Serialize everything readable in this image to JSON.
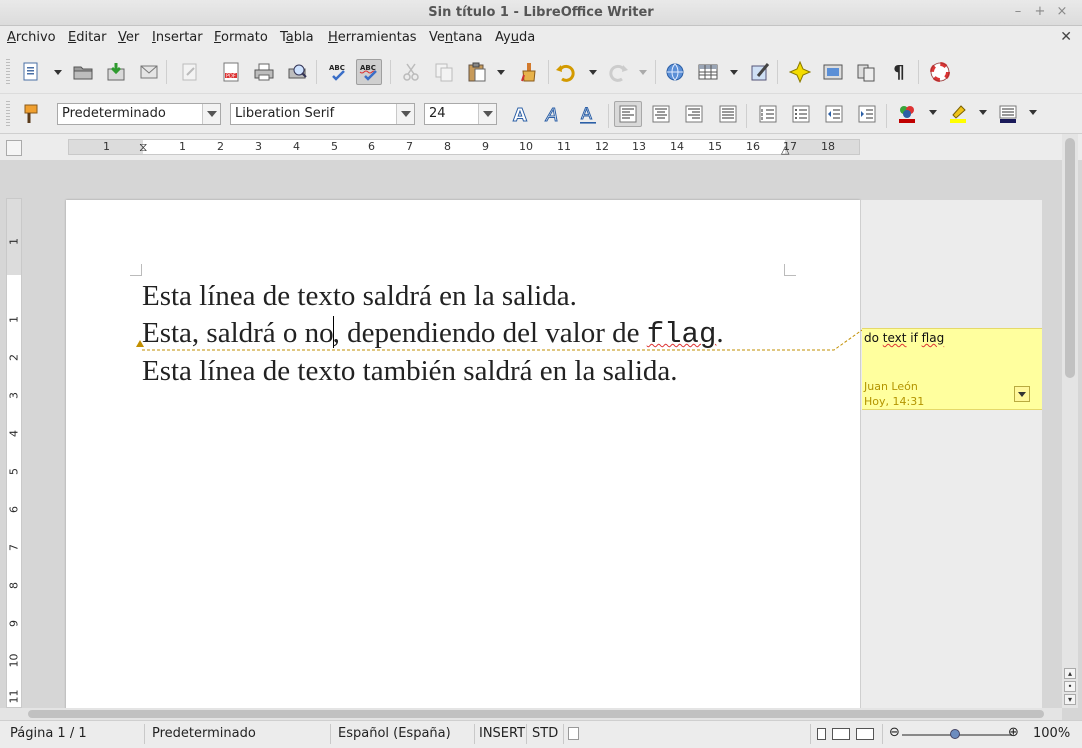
{
  "window": {
    "title": "Sin título 1 - LibreOffice Writer"
  },
  "menu": [
    {
      "label": "Archivo",
      "accel": "A",
      "rest": "rchivo"
    },
    {
      "label": "Editar",
      "accel": "E",
      "rest": "ditar"
    },
    {
      "label": "Ver",
      "accel": "V",
      "rest": "er"
    },
    {
      "label": "Insertar",
      "accel": "I",
      "rest": "nsertar"
    },
    {
      "label": "Formato",
      "accel": "F",
      "rest": "ormato"
    },
    {
      "label": "Tabla",
      "pre": "T",
      "accel": "a",
      "rest": "bla"
    },
    {
      "label": "Herramientas",
      "accel": "H",
      "rest": "erramientas"
    },
    {
      "label": "Ventana",
      "pre": "Ve",
      "accel": "n",
      "rest": "tana"
    },
    {
      "label": "Ayuda",
      "pre": "Ay",
      "accel": "u",
      "rest": "da"
    }
  ],
  "format_bar": {
    "paragraph_style": "Predeterminado",
    "font_name": "Liberation Serif",
    "font_size": "24"
  },
  "ruler": {
    "numbers": [
      "1",
      "1",
      "2",
      "3",
      "4",
      "5",
      "6",
      "7",
      "8",
      "9",
      "10",
      "11",
      "12",
      "13",
      "14",
      "15",
      "16",
      "17",
      "18"
    ]
  },
  "vruler": {
    "numbers": [
      "1",
      "1",
      "2",
      "3",
      "4",
      "5",
      "6",
      "7",
      "8",
      "9",
      "10",
      "11"
    ]
  },
  "document": {
    "line1": "Esta línea de texto saldrá en la salida.",
    "line2_before_cursor": "Esta, saldrá o no",
    "line2_after_cursor": ", dependiendo del valor de ",
    "line2_code": "flag",
    "line2_end": ".",
    "line3": "Esta línea de texto también saldrá en la salida."
  },
  "comment": {
    "text_a": "do ",
    "text_b": "text",
    "text_c": " if ",
    "text_d": "flag",
    "author": "Juan León",
    "date": "Hoy, 14:31"
  },
  "status": {
    "page": "Página  1 / 1",
    "style": "Predeterminado",
    "language": "Español (España)",
    "insert_mode": "INSERT",
    "selection_mode": "STD",
    "zoom": "100%"
  },
  "colors": {
    "comment_bg": "#ffff9e",
    "comment_meta": "#b39400",
    "highlight": "#ffff00",
    "font_color": "#c00000"
  }
}
